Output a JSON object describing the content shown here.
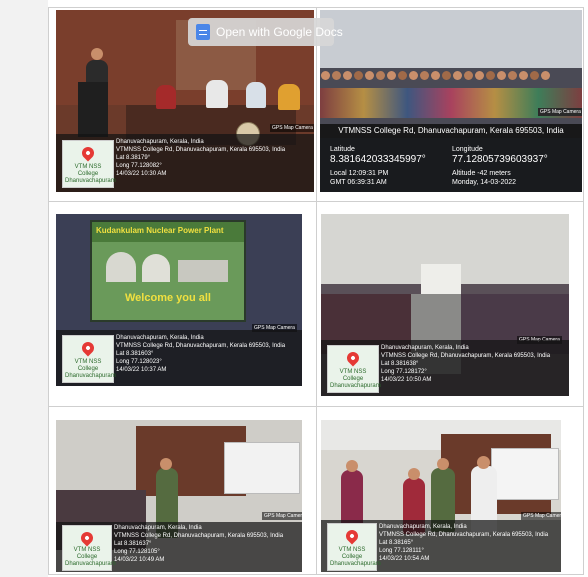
{
  "google_bar": {
    "label": "Open with Google Docs",
    "icon": "google-docs-icon"
  },
  "photos": {
    "p1": {
      "place": "Dhanuvachapuram, Kerala, India",
      "address": "VTMNSS College Rd, Dhanuvachapuram, Kerala 695503, India",
      "lat": "Lat 8.38179°",
      "long": "Long 77.128082°",
      "datetime": "14/03/22 10:30 AM",
      "badge": "GPS Map Camera",
      "map_caption": "VTM NSS College Dhanuvachapuram"
    },
    "p2": {
      "badge": "GPS Map Camera Lite",
      "title": "VTMNSS College Rd, Dhanuvachapuram, Kerala 695503, India",
      "lat_label": "Latitude",
      "lat_value": "8.3816420333459​97°",
      "long_label": "Longitude",
      "long_value": "77.12805739603937°",
      "local": "Local 12:09:31 PM",
      "gmt": "GMT 06:39:31 AM",
      "altitude": "Altitude -42 meters",
      "date": "Monday, 14-03-2022"
    },
    "p3": {
      "slide_title": "Kudankulam Nuclear Power Plant",
      "slide_welcome": "Welcome you all",
      "place": "Dhanuvachapuram, Kerala, India",
      "address": "VTMNSS College Rd, Dhanuvachapuram, Kerala 695503, India",
      "lat": "Lat 8.381603°",
      "long": "Long 77.128023°",
      "datetime": "14/03/22 10:37 AM",
      "badge": "GPS Map Camera",
      "map_caption": "VTM NSS College Dhanuvachapuram"
    },
    "p4": {
      "place": "Dhanuvachapuram, Kerala, India",
      "address": "VTMNSS College Rd, Dhanuvachapuram, Kerala 695503, India",
      "lat": "Lat 8.381638°",
      "long": "Long 77.128172°",
      "datetime": "14/03/22 10:50 AM",
      "badge": "GPS Map Camera",
      "map_caption": "VTM NSS College Dhanuvachapuram"
    },
    "p5": {
      "place": "Dhanuvachapuram, Kerala, India",
      "address": "VTMNSS College Rd, Dhanuvachapuram, Kerala 695503, India",
      "lat": "Lat 8.381637°",
      "long": "Long 77.128105°",
      "datetime": "14/03/22 10:49 AM",
      "badge": "GPS Map Camera",
      "map_caption": "VTM NSS College Dhanuvachapuram"
    },
    "p6": {
      "place": "Dhanuvachapuram, Kerala, India",
      "address": "VTMNSS College Rd, Dhanuvachapuram, Kerala 695503, India",
      "lat": "Lat 8.38165°",
      "long": "Long 77.128111°",
      "datetime": "14/03/22 10:54 AM",
      "badge": "GPS Map Camera",
      "map_caption": "VTM NSS College Dhanuvachapuram"
    }
  }
}
